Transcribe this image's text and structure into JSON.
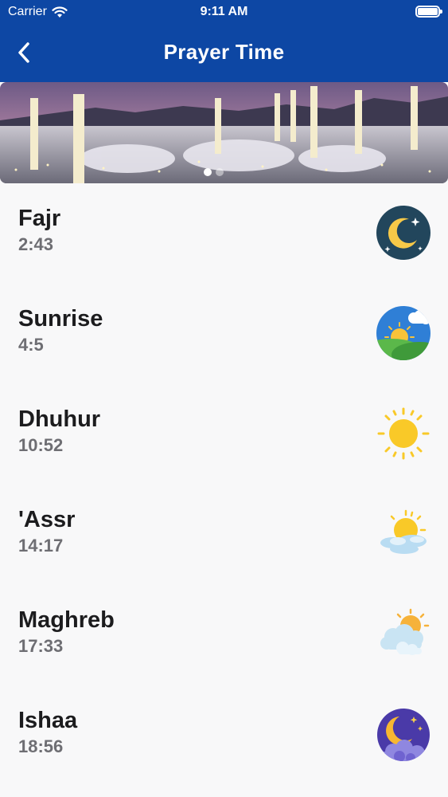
{
  "status_bar": {
    "carrier": "Carrier",
    "time": "9:11 AM"
  },
  "header": {
    "title": "Prayer Time"
  },
  "banner": {
    "page_count": 2,
    "active_page": 1
  },
  "prayers": [
    {
      "name": "Fajr",
      "time": "2:43",
      "icon": "crescent-moon-night-icon"
    },
    {
      "name": "Sunrise",
      "time": "4:5",
      "icon": "sunrise-landscape-icon"
    },
    {
      "name": "Dhuhur",
      "time": "10:52",
      "icon": "sun-icon"
    },
    {
      "name": "'Assr",
      "time": "14:17",
      "icon": "sun-behind-cloud-icon"
    },
    {
      "name": "Maghreb",
      "time": "17:33",
      "icon": "sun-setting-cloud-icon"
    },
    {
      "name": "Ishaa",
      "time": "18:56",
      "icon": "night-moon-clouds-icon"
    }
  ],
  "colors": {
    "header_bg": "#0d47a4",
    "page_bg": "#f8f8f9",
    "name_text": "#1c1c1e",
    "time_text": "#6e6e73"
  }
}
